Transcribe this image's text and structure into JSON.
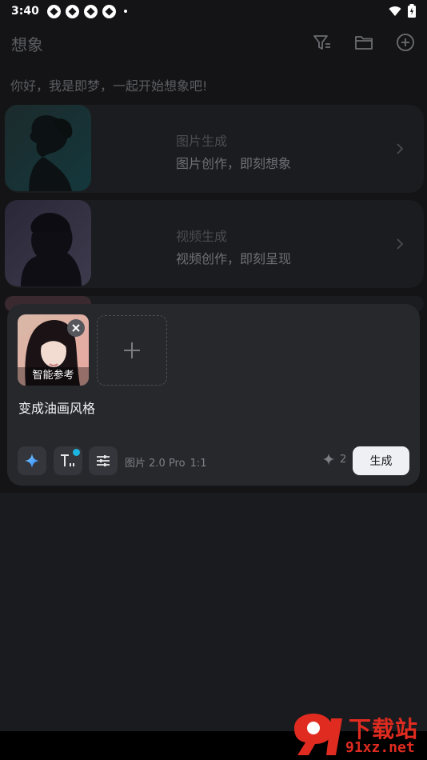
{
  "status_bar": {
    "time": "3:40"
  },
  "header": {
    "title": "想象",
    "filter_icon": "filter-icon",
    "folder_icon": "folder-icon",
    "add_icon": "add-circle-icon"
  },
  "greeting": "你好，我是即梦，一起开始想象吧!",
  "cards": [
    {
      "title": "图片生成",
      "subtitle": "图片创作，即刻想象"
    },
    {
      "title": "视频生成",
      "subtitle": "视频创作，即刻呈现"
    }
  ],
  "composer": {
    "reference_label": "智能参考",
    "prompt": "变成油画风格",
    "model": "图片 2.0 Pro",
    "ratio": "1:1",
    "credits": "2",
    "generate_label": "生成"
  },
  "watermark": {
    "top": "下载站",
    "bottom": "91xz.net"
  },
  "colors": {
    "background": "#141416",
    "card": "#1b1c1f",
    "composer": "#26282c",
    "accent": "#1bb5e0",
    "button": "#eef0f3"
  }
}
